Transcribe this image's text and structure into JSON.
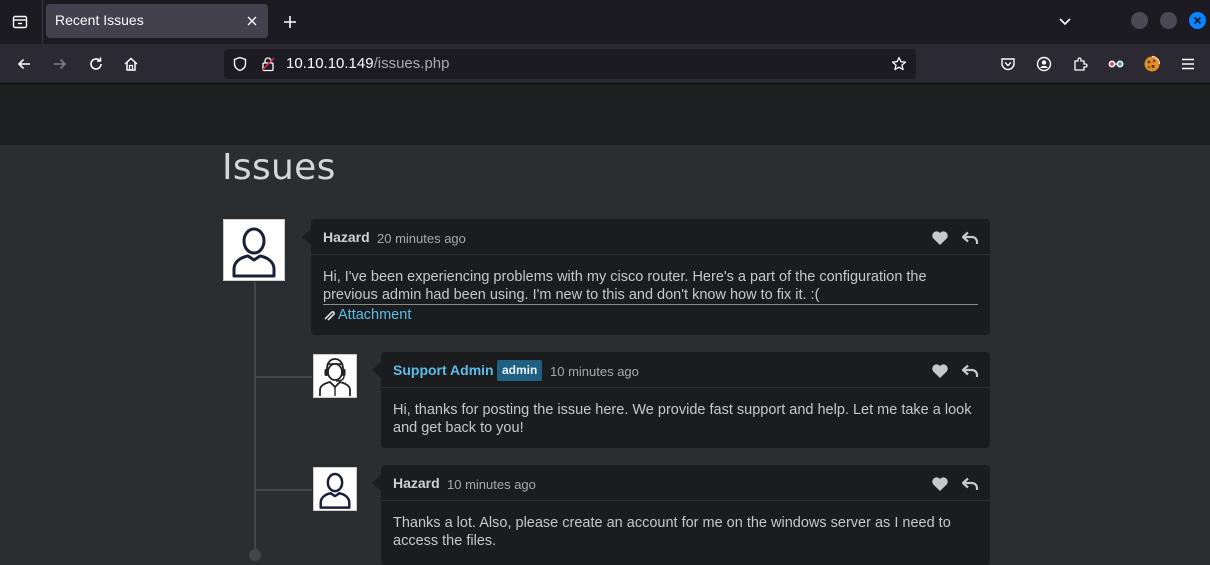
{
  "browser": {
    "tab_title": "Recent Issues",
    "url_host": "10.10.10.149",
    "url_path": "/issues.php"
  },
  "page": {
    "title": "Issues"
  },
  "issues": [
    {
      "author": "Hazard",
      "time": "20 minutes ago",
      "body": "Hi, I've been experiencing problems with my cisco router. Here's a part of the configuration the previous admin had been using. I'm new to this and don't know how to fix it. :(",
      "attachment_label": "Attachment"
    },
    {
      "author": "Support Admin",
      "badge": "admin",
      "time": "10 minutes ago",
      "body": "Hi, thanks for posting the issue here. We provide fast support and help. Let me take a look and get back to you!"
    },
    {
      "author": "Hazard",
      "time": "10 minutes ago",
      "body": "Thanks a lot. Also, please create an account for me on the windows server as I need to access the files."
    }
  ],
  "colors": {
    "accent": "#5dbde9",
    "badge_bg": "#1f5f82",
    "page_bg": "#2b2e30",
    "card_bg": "#1b1c1e"
  }
}
